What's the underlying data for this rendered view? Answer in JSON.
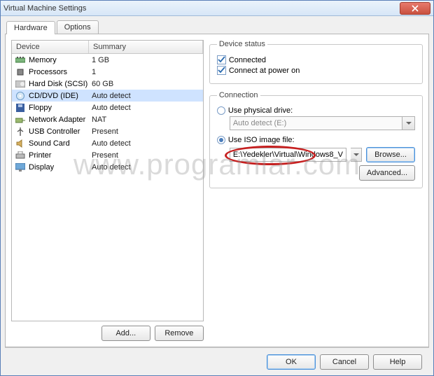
{
  "window": {
    "title": "Virtual Machine Settings"
  },
  "tabs": {
    "hardware": "Hardware",
    "options": "Options"
  },
  "table": {
    "col_device": "Device",
    "col_summary": "Summary",
    "rows": [
      {
        "name": "Memory",
        "summary": "1 GB",
        "icon": "memory"
      },
      {
        "name": "Processors",
        "summary": "1",
        "icon": "cpu"
      },
      {
        "name": "Hard Disk (SCSI)",
        "summary": "60 GB",
        "icon": "hdd"
      },
      {
        "name": "CD/DVD (IDE)",
        "summary": "Auto detect",
        "icon": "cd"
      },
      {
        "name": "Floppy",
        "summary": "Auto detect",
        "icon": "floppy"
      },
      {
        "name": "Network Adapter",
        "summary": "NAT",
        "icon": "net"
      },
      {
        "name": "USB Controller",
        "summary": "Present",
        "icon": "usb"
      },
      {
        "name": "Sound Card",
        "summary": "Auto detect",
        "icon": "sound"
      },
      {
        "name": "Printer",
        "summary": "Present",
        "icon": "printer"
      },
      {
        "name": "Display",
        "summary": "Auto detect",
        "icon": "display"
      }
    ]
  },
  "buttons": {
    "add": "Add...",
    "remove": "Remove",
    "browse": "Browse...",
    "advanced": "Advanced...",
    "ok": "OK",
    "cancel": "Cancel",
    "help": "Help"
  },
  "status": {
    "legend": "Device status",
    "connected": "Connected",
    "connect_power": "Connect at power on"
  },
  "connection": {
    "legend": "Connection",
    "use_physical": "Use physical drive:",
    "physical_value": "Auto detect (E:)",
    "use_iso": "Use ISO image file:",
    "iso_value": "E:\\Yedekler\\Virtual\\Windows8_V"
  },
  "watermark": "www.programlar.com"
}
